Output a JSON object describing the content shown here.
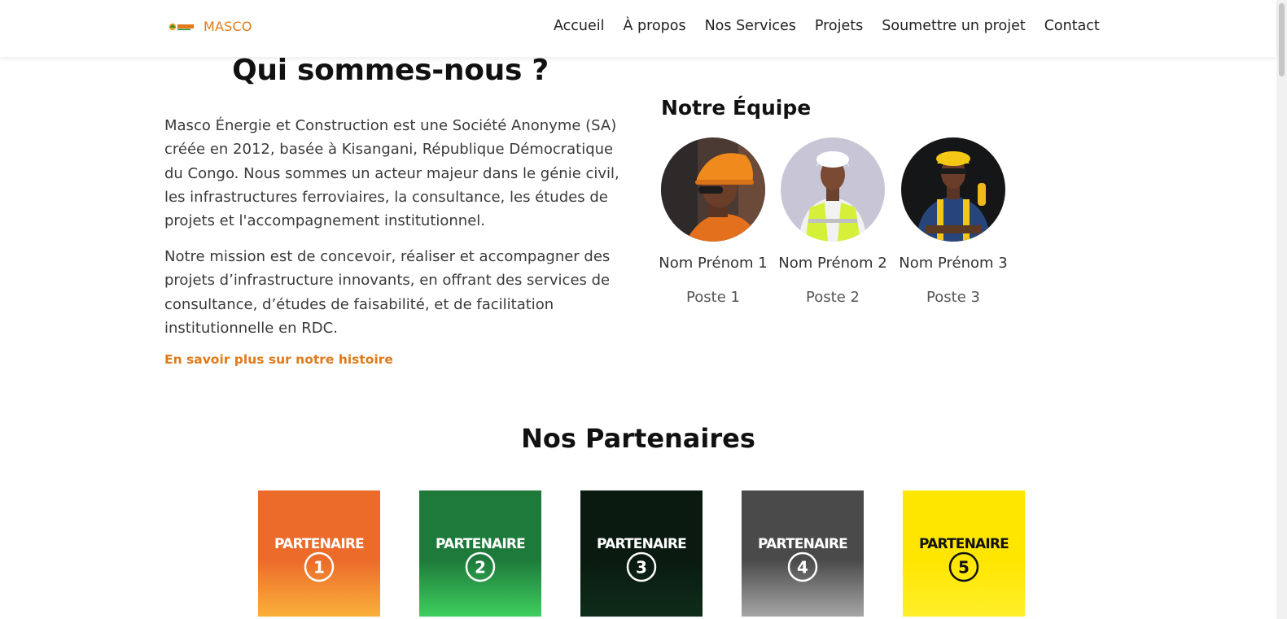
{
  "brand": {
    "name": "MASCO",
    "logo_icon": "masco-logo-icon"
  },
  "nav": {
    "items": [
      {
        "label": "Accueil"
      },
      {
        "label": "À propos"
      },
      {
        "label": "Nos Services"
      },
      {
        "label": "Projets"
      },
      {
        "label": "Soumettre un projet"
      },
      {
        "label": "Contact"
      }
    ]
  },
  "about": {
    "title": "Qui sommes-nous ?",
    "paragraph1": "Masco Énergie et Construction est une Société Anonyme (SA) créée en 2012, basée à Kisangani, République Démocratique du Congo. Nous sommes un acteur majeur dans le génie civil, les infrastructures ferroviaires, la consultance, les études de projets et l'accompagnement institutionnel.",
    "paragraph2": "Notre mission est de concevoir, réaliser et accompagner des projets d’infrastructure innovants, en offrant des services de consultance, d’études de faisabilité, et de facilitation institutionnelle en RDC.",
    "link": "En savoir plus sur notre histoire"
  },
  "team": {
    "title": "Notre Équipe",
    "members": [
      {
        "name": "Nom Prénom 1",
        "role": "Poste 1"
      },
      {
        "name": "Nom Prénom 2",
        "role": "Poste 2"
      },
      {
        "name": "Nom Prénom 3",
        "role": "Poste 3"
      }
    ]
  },
  "partners": {
    "title": "Nos Partenaires",
    "items": [
      {
        "label": "PARTENAIRE",
        "number": "1",
        "color_top": "#ec6b2a",
        "color_bottom": "#fbb03b",
        "text_color": "#ffffff"
      },
      {
        "label": "PARTENAIRE",
        "number": "2",
        "color_top": "#1e7a3b",
        "color_bottom": "#3ecf5e",
        "text_color": "#ffffff"
      },
      {
        "label": "PARTENAIRE",
        "number": "3",
        "color_top": "#0a1a10",
        "color_bottom": "#0f2d1a",
        "text_color": "#ffffff"
      },
      {
        "label": "PARTENAIRE",
        "number": "4",
        "color_top": "#4a4a4a",
        "color_bottom": "#a6a6a6",
        "text_color": "#ffffff"
      },
      {
        "label": "PARTENAIRE",
        "number": "5",
        "color_top": "#ffe600",
        "color_bottom": "#ffef2a",
        "text_color": "#111111"
      }
    ]
  },
  "colors": {
    "accent": "#e07a1a",
    "heading": "#111111",
    "text": "#3a3a3a"
  }
}
